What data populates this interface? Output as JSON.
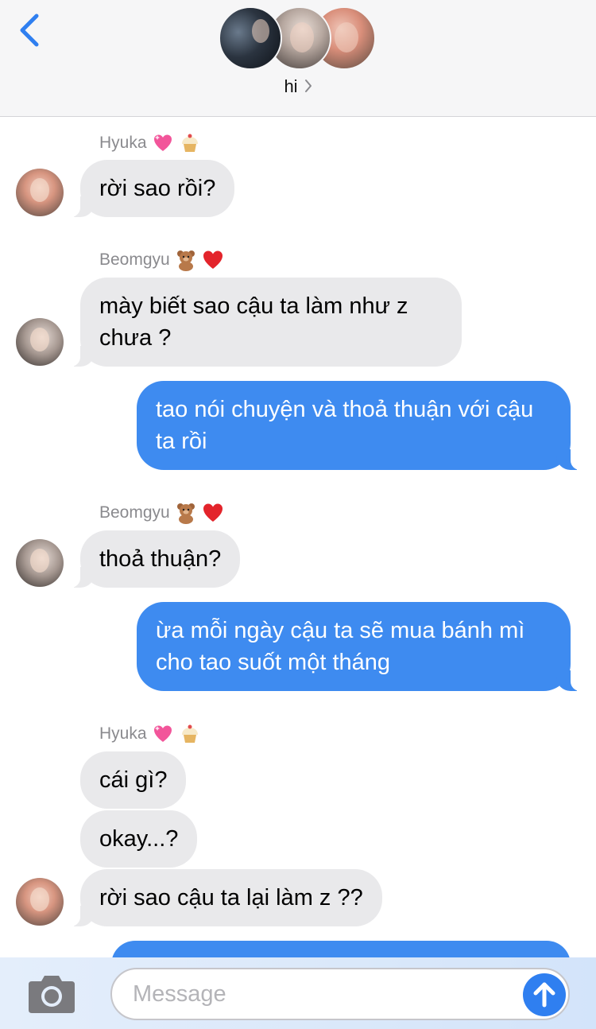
{
  "header": {
    "back_icon": "chevron-left-icon",
    "group_name": "hi",
    "chevron_icon": "chevron-right-icon",
    "accent": "#2f7ff0"
  },
  "messages": [
    {
      "sender": "Hyuka",
      "sender_emojis": [
        "sparkling-heart-emoji",
        "cupcake-emoji"
      ],
      "direction": "in",
      "text": "rời sao rồi?"
    },
    {
      "sender": "Beomgyu",
      "sender_emojis": [
        "teddy-bear-emoji",
        "red-heart-emoji"
      ],
      "direction": "in",
      "text": "mày biết sao cậu ta làm như z chưa ?"
    },
    {
      "direction": "out",
      "text": "tao nói chuyện và thoả thuận với cậu ta rồi"
    },
    {
      "sender": "Beomgyu",
      "sender_emojis": [
        "teddy-bear-emoji",
        "red-heart-emoji"
      ],
      "direction": "in",
      "text": "thoả thuận?"
    },
    {
      "direction": "out",
      "text": "ừa mỗi ngày cậu ta sẽ mua bánh mì cho tao suốt một tháng"
    },
    {
      "sender": "Hyuka",
      "sender_emojis": [
        "sparkling-heart-emoji",
        "cupcake-emoji"
      ],
      "direction": "in",
      "text": "cái gì?"
    },
    {
      "direction": "in",
      "text": "okay...?"
    },
    {
      "direction": "in",
      "text": "rời sao cậu ta lại làm z ??"
    }
  ],
  "composer": {
    "placeholder": "Message",
    "camera_icon": "camera-icon",
    "send_icon": "arrow-up-icon"
  },
  "colors": {
    "incoming_bubble": "#e9e9eb",
    "outgoing_bubble": "#3e8bf0",
    "sender_label": "#8a8a8e"
  }
}
